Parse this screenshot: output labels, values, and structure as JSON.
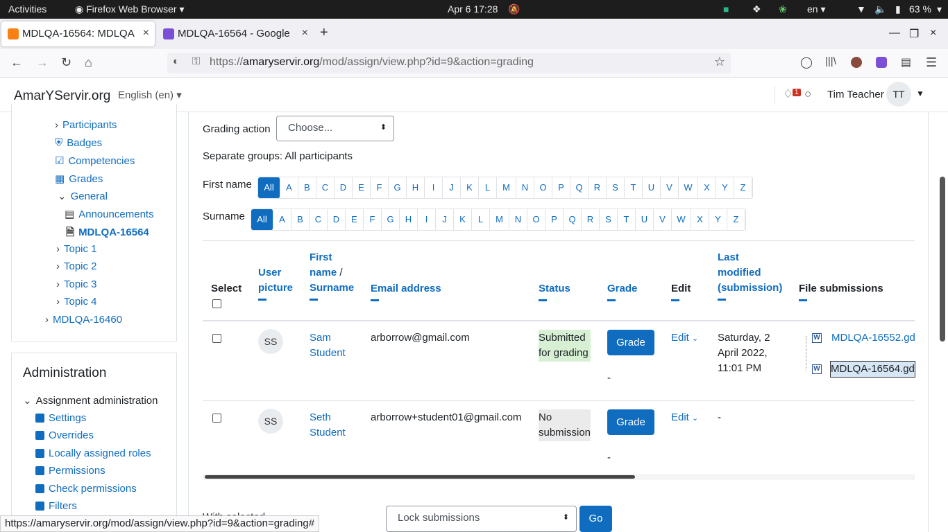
{
  "topbar": {
    "activities": "Activities",
    "app": "Firefox Web Browser",
    "clock": "Apr 6  17:28",
    "lang": "en",
    "battery": "63 %"
  },
  "tabs": [
    {
      "title": "MDLQA-16564: MDLQA"
    },
    {
      "title": "MDLQA-16564 - Google"
    }
  ],
  "urlbar": {
    "prefix": "https://",
    "host": "amaryservir.org",
    "path": "/mod/assign/view.php?id=9&action=grading"
  },
  "header": {
    "site": "AmarYServir.org",
    "language": "English (en)",
    "notif_count": "1",
    "user": "Tim Teacher",
    "initials": "TT"
  },
  "nav": {
    "items": [
      {
        "label": "Participants"
      },
      {
        "label": "Badges"
      },
      {
        "label": "Competencies"
      },
      {
        "label": "Grades"
      },
      {
        "label": "General"
      },
      {
        "label": "Announcements"
      },
      {
        "label": "MDLQA-16564"
      },
      {
        "label": "Topic 1"
      },
      {
        "label": "Topic 2"
      },
      {
        "label": "Topic 3"
      },
      {
        "label": "Topic 4"
      },
      {
        "label": "MDLQA-16460"
      }
    ]
  },
  "admin": {
    "title": "Administration",
    "section": "Assignment administration",
    "items": [
      {
        "label": "Settings"
      },
      {
        "label": "Overrides"
      },
      {
        "label": "Locally assigned roles"
      },
      {
        "label": "Permissions"
      },
      {
        "label": "Check permissions"
      },
      {
        "label": "Filters"
      }
    ]
  },
  "grading": {
    "action_label": "Grading action",
    "action_value": "Choose...",
    "groups": "Separate groups: All participants",
    "firstname_label": "First name",
    "surname_label": "Surname",
    "letters": [
      "All",
      "A",
      "B",
      "C",
      "D",
      "E",
      "F",
      "G",
      "H",
      "I",
      "J",
      "K",
      "L",
      "M",
      "N",
      "O",
      "P",
      "Q",
      "R",
      "S",
      "T",
      "U",
      "V",
      "W",
      "X",
      "Y",
      "Z"
    ]
  },
  "table": {
    "headers": {
      "select": "Select",
      "picture1": "User",
      "picture2": "picture",
      "name1": "First",
      "name2": "name",
      "name3": "Surname",
      "slash": " /",
      "email": "Email address",
      "status": "Status",
      "grade": "Grade",
      "edit": "Edit",
      "lm1": "Last",
      "lm2": "modified",
      "lm3": "(submission)",
      "files": "File submissions"
    },
    "rows": [
      {
        "initials": "SS",
        "first": "Sam",
        "last": "Student",
        "email": "arborrow@gmail.com",
        "status1": "Submitted",
        "status2": "for grading",
        "grade_btn": "Grade",
        "grade_val": "-",
        "edit": "Edit",
        "mod1": "Saturday, 2",
        "mod2": "April 2022,",
        "mod3": "11:01 PM",
        "file1": "MDLQA-16552.gd",
        "file2": "MDLQA-16564.gd"
      },
      {
        "initials": "SS",
        "first": "Seth",
        "last": "Student",
        "email": "arborrow+student01@gmail.com",
        "status1": "No",
        "status2": "submission",
        "grade_btn": "Grade",
        "grade_val": "-",
        "edit": "Edit",
        "mod1": "-"
      }
    ]
  },
  "bulk": {
    "label": "With selected...",
    "action": "Lock submissions",
    "go": "Go"
  },
  "statusbar": "https://amaryservir.org/mod/assign/view.php?id=9&action=grading#",
  "colors": {
    "accent": "#0f6cbf",
    "submitted_bg": "#d7f0d4",
    "nosub_bg": "#ebebeb"
  }
}
